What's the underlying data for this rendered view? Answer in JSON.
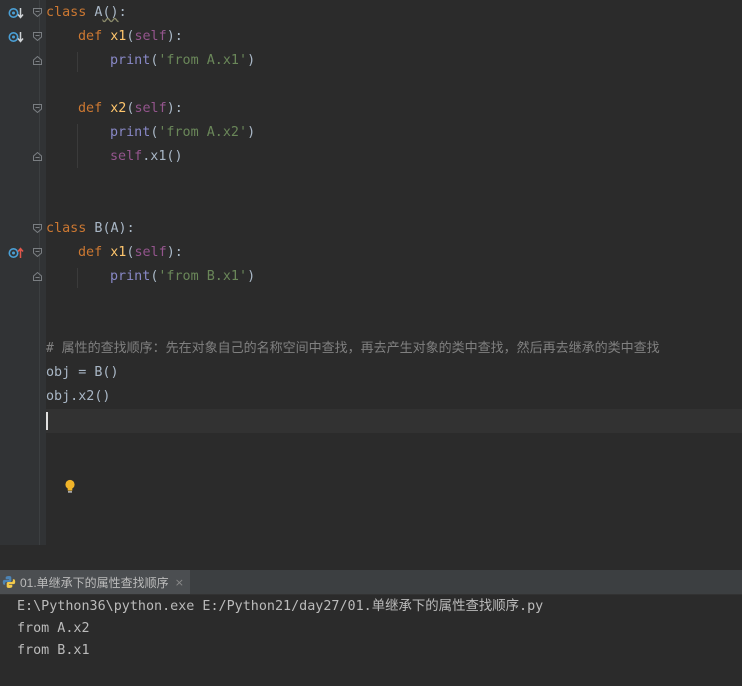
{
  "editor": {
    "lines": [
      {
        "kind": "class_def",
        "kw": "class",
        "name": "A",
        "paren": "()",
        "colon": ":"
      },
      {
        "kind": "def",
        "kw": "def",
        "name": "x1",
        "open": "(",
        "self": "self",
        "close": "):"
      },
      {
        "kind": "print",
        "fn": "print",
        "open": "(",
        "str": "'from A.x1'",
        "close": ")"
      },
      {
        "kind": "def",
        "kw": "def",
        "name": "x2",
        "open": "(",
        "self": "self",
        "close": "):"
      },
      {
        "kind": "print",
        "fn": "print",
        "open": "(",
        "str": "'from A.x2'",
        "close": ")"
      },
      {
        "kind": "call",
        "self": "self",
        "rest": ".x1()"
      },
      {
        "kind": "class_def",
        "kw": "class",
        "name": "B",
        "paren": "(A)",
        "colon": ":"
      },
      {
        "kind": "def",
        "kw": "def",
        "name": "x1",
        "open": "(",
        "self": "self",
        "close": "):"
      },
      {
        "kind": "print",
        "fn": "print",
        "open": "(",
        "str": "'from B.x1'",
        "close": ")"
      },
      {
        "kind": "comment",
        "text": "# 属性的查找顺序：先在对象自己的名称空间中查找，再去产生对象的类中查找，然后再去继承的类中查找"
      },
      {
        "kind": "plain",
        "text": "obj = B()"
      },
      {
        "kind": "plain",
        "text": "obj.x2()"
      }
    ]
  },
  "run_panel": {
    "tab_label": "01.单继承下的属性查找顺序",
    "close_glyph": "×",
    "output": [
      "E:\\Python36\\python.exe E:/Python21/day27/01.单继承下的属性查找顺序.py",
      "from A.x2",
      "from B.x1"
    ]
  },
  "colors": {
    "editor_bg": "#2b2b2b",
    "keyword": "#cc7832",
    "function_name": "#ffc66d",
    "self": "#94558d",
    "string": "#6a8759",
    "builtin": "#8888c6",
    "comment": "#808080",
    "text": "#a9b7c6"
  }
}
